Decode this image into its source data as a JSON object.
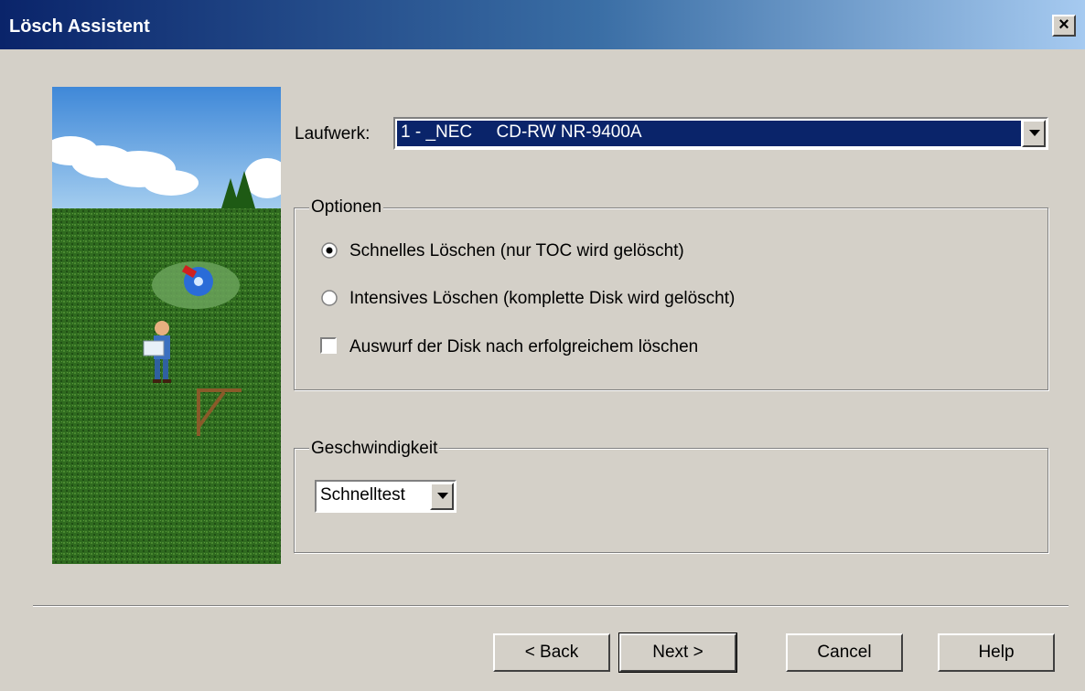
{
  "window": {
    "title": "Lösch Assistent",
    "close_glyph": "×"
  },
  "drive": {
    "label": "Laufwerk:",
    "value": "1 - _NEC     CD-RW NR-9400A"
  },
  "options": {
    "legend": "Optionen",
    "radio_quick": "Schnelles Löschen (nur TOC wird gelöscht)",
    "radio_full": "Intensives Löschen (komplette Disk wird gelöscht)",
    "eject_checkbox": "Auswurf der Disk nach erfolgreichem löschen",
    "selected": "quick",
    "eject_checked": false
  },
  "speed": {
    "legend": "Geschwindigkeit",
    "value": "Schnelltest"
  },
  "buttons": {
    "back": "< Back",
    "next": "Next >",
    "cancel": "Cancel",
    "help": "Help"
  },
  "colors": {
    "title_start": "#0a246a",
    "title_end": "#a6caf0",
    "selection": "#0a246a",
    "face": "#d4d0c8"
  }
}
